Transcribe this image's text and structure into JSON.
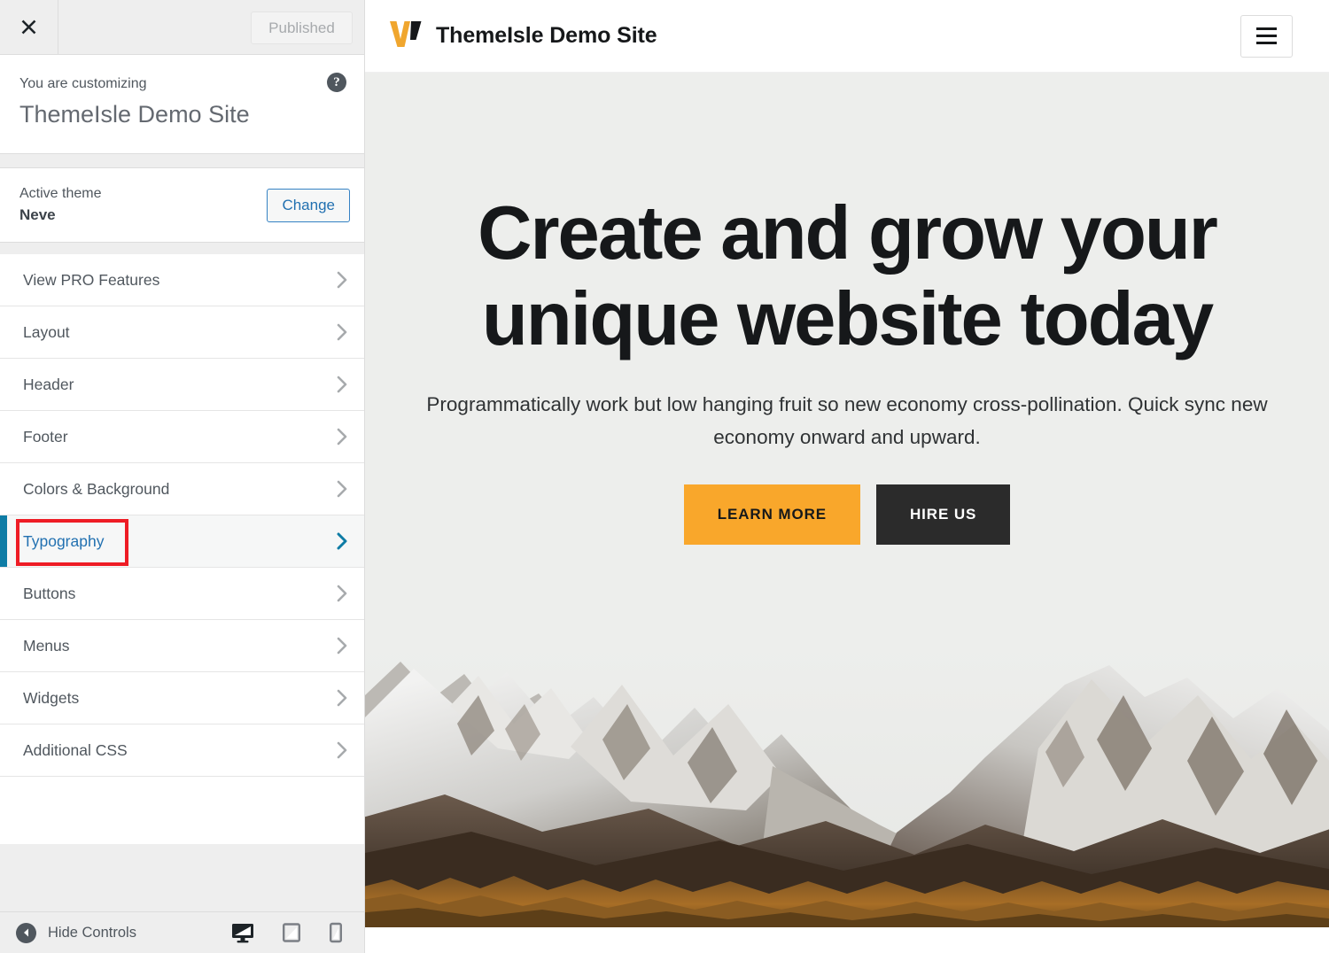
{
  "customizer": {
    "close_icon": "close-icon",
    "publish_button": "Published",
    "customizing_label": "You are customizing",
    "site_title": "ThemeIsle Demo Site",
    "help_icon": "help-icon",
    "theme": {
      "active_label": "Active theme",
      "name": "Neve",
      "change_button": "Change"
    },
    "nav_items": [
      {
        "label": "View PRO Features",
        "active": false
      },
      {
        "label": "Layout",
        "active": false
      },
      {
        "label": "Header",
        "active": false
      },
      {
        "label": "Footer",
        "active": false
      },
      {
        "label": "Colors & Background",
        "active": false
      },
      {
        "label": "Typography",
        "active": true
      },
      {
        "label": "Buttons",
        "active": false
      },
      {
        "label": "Menus",
        "active": false
      },
      {
        "label": "Widgets",
        "active": false
      },
      {
        "label": "Additional CSS",
        "active": false
      }
    ],
    "footer": {
      "hide_controls": "Hide Controls",
      "devices": [
        {
          "name": "desktop-preview-icon",
          "active": true
        },
        {
          "name": "tablet-preview-icon",
          "active": false
        },
        {
          "name": "mobile-preview-icon",
          "active": false
        }
      ]
    },
    "annotation": {
      "target": "Typography",
      "color": "#ee1c25"
    }
  },
  "preview": {
    "header": {
      "logo_icon": "themeisle-w-logo-icon",
      "site_name": "ThemeIsle Demo Site",
      "menu_icon": "hamburger-menu-icon"
    },
    "hero": {
      "title": "Create and grow your unique website today",
      "subtitle": "Programmatically work but low hanging fruit so new economy cross-pollination. Quick sync new",
      "subtitle_line2": "economy onward and upward.",
      "primary_button": "LEARN MORE",
      "secondary_button": "HIRE US",
      "background_image": "snowy-mountain-range-photo"
    }
  },
  "colors": {
    "accent_orange": "#f9a72b",
    "dark": "#2b2b2b",
    "wp_blue": "#2271b1",
    "active_border": "#0e7ca5",
    "hero_bg": "#edeeec",
    "annotation_red": "#ee1c25"
  }
}
